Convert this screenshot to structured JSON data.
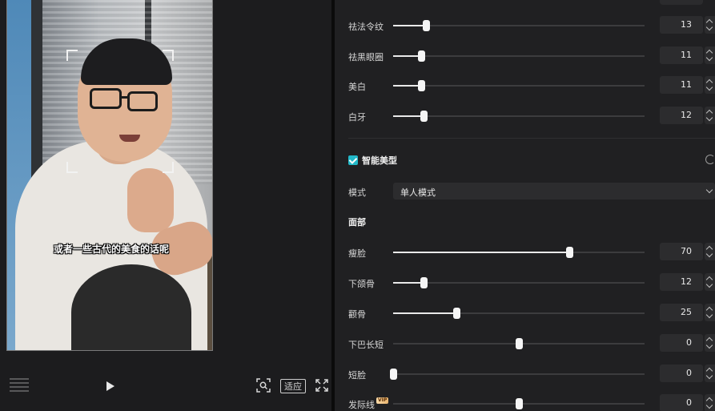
{
  "preview": {
    "subtitle": "或者一些古代的美食的话呢",
    "controls": {
      "fit_label": "适应",
      "icons": [
        "grid-icon",
        "play-icon",
        "scan-icon",
        "fullscreen-icon"
      ]
    }
  },
  "settings": {
    "accent_color": "#22b8c8",
    "sliders_top": [
      {
        "label": "祛法令纹",
        "value": 13,
        "percent": 13
      },
      {
        "label": "祛黑眼圈",
        "value": 11,
        "percent": 11
      },
      {
        "label": "美白",
        "value": 11,
        "percent": 11
      },
      {
        "label": "白牙",
        "value": 12,
        "percent": 12
      }
    ],
    "smart_shape": {
      "title": "智能美型",
      "checked": true,
      "mode_label": "模式",
      "mode_value": "单人模式",
      "face_heading": "面部",
      "sliders": [
        {
          "label": "瘦脸",
          "value": 70,
          "percent": 70
        },
        {
          "label": "下颌骨",
          "value": 12,
          "percent": 12
        },
        {
          "label": "颧骨",
          "value": 25,
          "percent": 25
        },
        {
          "label": "下巴长短",
          "value": 0,
          "percent": 50
        },
        {
          "label": "短脸",
          "value": 0,
          "percent": 0
        },
        {
          "label": "发际线",
          "value": 0,
          "percent": 50,
          "badge": "VIP"
        }
      ]
    }
  }
}
